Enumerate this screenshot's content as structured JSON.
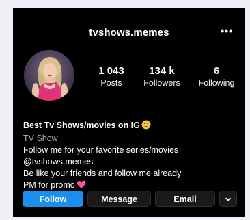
{
  "profile": {
    "username": "tvshows.memes",
    "more_icon": "more-horizontal-icon",
    "stats": {
      "posts_value": "1 043",
      "posts_label": "Posts",
      "followers_value": "134 k",
      "followers_label": "Followers",
      "following_value": "6",
      "following_label": "Following"
    },
    "bio": {
      "name": "Best Tv Shows/movies on IG",
      "name_emoji": "grinning-face-emoji",
      "category": "TV Show",
      "line1": "Follow me for your favorite series/movies",
      "line2": "@tvshows.memes",
      "line3": "Be like your friends and follow me already",
      "line4": "PM for promo",
      "line4_emoji": "sparkling-heart-emoji"
    },
    "buttons": {
      "follow": "Follow",
      "message": "Message",
      "email": "Email",
      "dropdown_icon": "chevron-down-icon"
    }
  },
  "colors": {
    "background": "#000000",
    "page": "#eef0f6",
    "accent": "#1a8ff0",
    "secondary_button": "#1a1a1a",
    "muted_text": "#a8a8a8"
  }
}
